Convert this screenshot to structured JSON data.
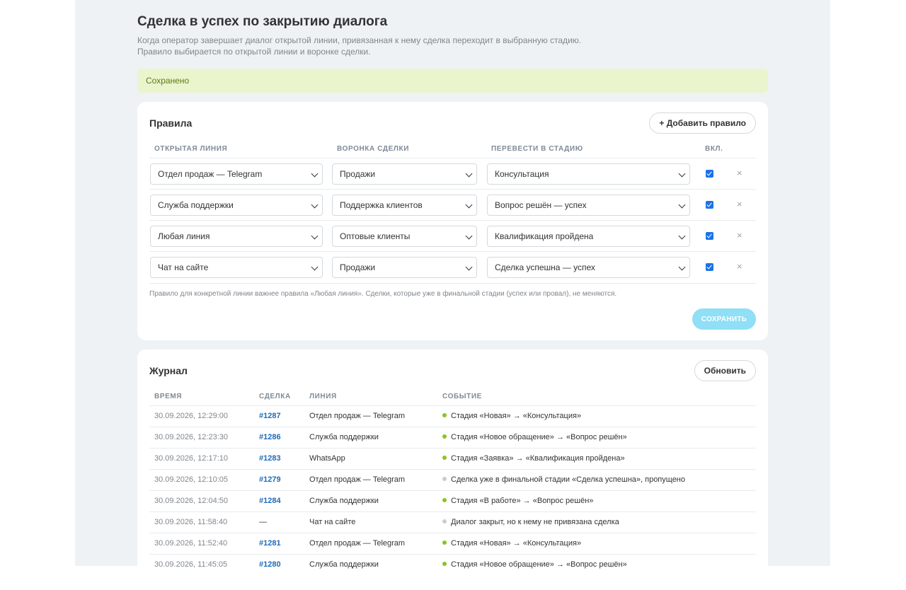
{
  "title": "Сделка в успех по закрытию диалога",
  "description_line1": "Когда оператор завершает диалог открытой линии, привязанная к нему сделка переходит в выбранную стадию.",
  "description_line2": "Правило выбирается по открытой линии и воронке сделки.",
  "notice": "Сохранено",
  "rules": {
    "title": "Правила",
    "add_button": "+ Добавить правило",
    "columns": {
      "line": "Открытая линия",
      "funnel": "Воронка сделки",
      "stage": "Перевести в стадию",
      "enabled": "Вкл."
    },
    "rows": [
      {
        "line": "Отдел продаж — Telegram",
        "funnel": "Продажи",
        "stage": "Консультация",
        "enabled": true
      },
      {
        "line": "Служба поддержки",
        "funnel": "Поддержка клиентов",
        "stage": "Вопрос решён — успех",
        "enabled": true
      },
      {
        "line": "Любая линия",
        "funnel": "Оптовые клиенты",
        "stage": "Квалификация пройдена",
        "enabled": true
      },
      {
        "line": "Чат на сайте",
        "funnel": "Продажи",
        "stage": "Сделка успешна — успех",
        "enabled": true
      }
    ],
    "delete_glyph": "×",
    "hint": "Правило для конкретной линии важнее правила «Любая линия». Сделки, которые уже в финальной стадии (успех или провал), не меняются.",
    "save_button": "СОХРАНИТЬ"
  },
  "log": {
    "title": "Журнал",
    "refresh_button": "Обновить",
    "columns": {
      "time": "Время",
      "deal": "Сделка",
      "line": "Линия",
      "event": "Событие"
    },
    "rows": [
      {
        "time": "30.09.2026, 12:29:00",
        "deal": "#1287",
        "line": "Отдел продаж — Telegram",
        "event": "Стадия «Новая» → «Консультация»",
        "status": "ok"
      },
      {
        "time": "30.09.2026, 12:23:30",
        "deal": "#1286",
        "line": "Служба поддержки",
        "event": "Стадия «Новое обращение» → «Вопрос решён»",
        "status": "ok"
      },
      {
        "time": "30.09.2026, 12:17:10",
        "deal": "#1283",
        "line": "WhatsApp",
        "event": "Стадия «Заявка» → «Квалификация пройдена»",
        "status": "ok"
      },
      {
        "time": "30.09.2026, 12:10:05",
        "deal": "#1279",
        "line": "Отдел продаж — Telegram",
        "event": "Сделка уже в финальной стадии «Сделка успешна», пропущено",
        "status": "skip"
      },
      {
        "time": "30.09.2026, 12:04:50",
        "deal": "#1284",
        "line": "Служба поддержки",
        "event": "Стадия «В работе» → «Вопрос решён»",
        "status": "ok"
      },
      {
        "time": "30.09.2026, 11:58:40",
        "deal": "—",
        "line": "Чат на сайте",
        "event": "Диалог закрыт, но к нему не привязана сделка",
        "status": "skip"
      },
      {
        "time": "30.09.2026, 11:52:40",
        "deal": "#1281",
        "line": "Отдел продаж — Telegram",
        "event": "Стадия «Новая» → «Консультация»",
        "status": "ok"
      },
      {
        "time": "30.09.2026, 11:45:05",
        "deal": "#1280",
        "line": "Служба поддержки",
        "event": "Стадия «Новое обращение» → «Вопрос решён»",
        "status": "ok"
      }
    ]
  },
  "colors": {
    "status_ok": "#8ec31f",
    "status_skip": "#c7ccd1",
    "link": "#1f6bb8",
    "save_button": "#8fdff6",
    "checkbox": "#1a73e8"
  }
}
